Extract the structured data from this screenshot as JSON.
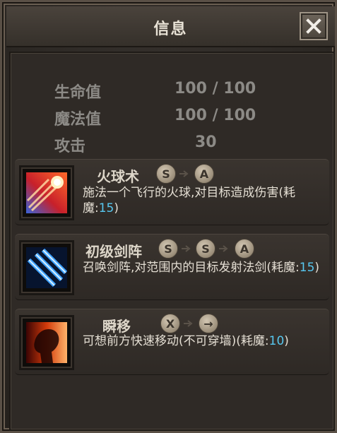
{
  "header": {
    "title": "信息"
  },
  "stats": [
    {
      "label": "生命值",
      "value": "100 / 100"
    },
    {
      "label": "魔法值",
      "value": "100 / 100"
    },
    {
      "label": "攻击",
      "value": "30"
    }
  ],
  "skills": [
    {
      "name": "火球术",
      "keys": [
        "S",
        "A"
      ],
      "desc_prefix": "施法一个飞行的火球,对目标造成伤害(耗魔:",
      "cost": "15",
      "desc_suffix": ")",
      "icon": "fireball-icon"
    },
    {
      "name": "初级剑阵",
      "keys": [
        "S",
        "S",
        "A"
      ],
      "desc_prefix": "召唤剑阵,对范围内的目标发射法剑(耗魔:",
      "cost": "15",
      "desc_suffix": ")",
      "icon": "sword-array-icon"
    },
    {
      "name": "瞬移",
      "keys": [
        "X",
        "→"
      ],
      "desc_prefix": "可想前方快速移动(不可穿墙)(耗魔:",
      "cost": "10",
      "desc_suffix": ")",
      "icon": "teleport-icon"
    }
  ],
  "colors": {
    "cost_number": "#57c7ef",
    "stat_text": "#8c8a86",
    "title_text": "#e8e2d6"
  }
}
